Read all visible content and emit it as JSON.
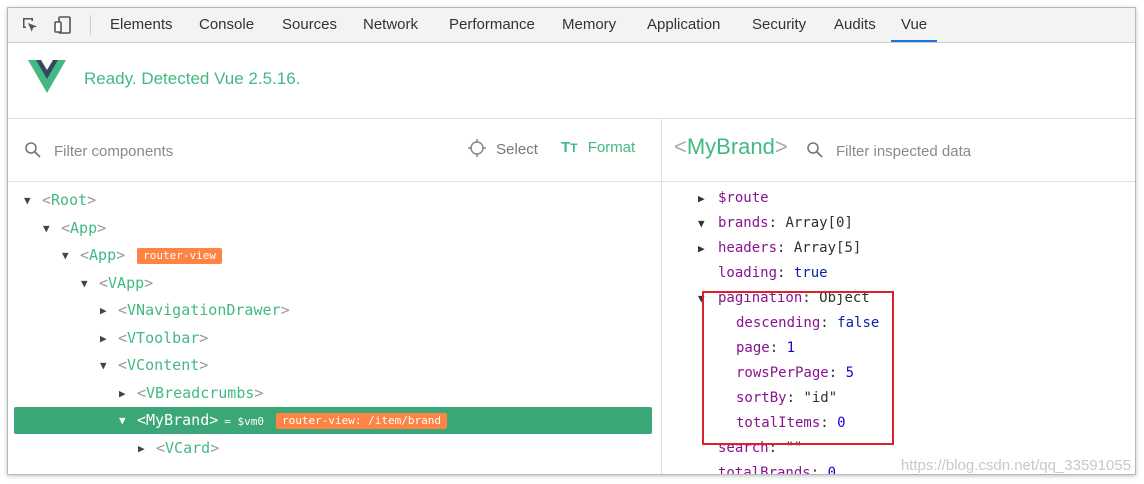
{
  "tabs": [
    "Elements",
    "Console",
    "Sources",
    "Network",
    "Performance",
    "Memory",
    "Application",
    "Security",
    "Audits",
    "Vue"
  ],
  "active_tab": "Vue",
  "header": {
    "status": "Ready. Detected Vue 2.5.16."
  },
  "left": {
    "filter_placeholder": "Filter components",
    "select_label": "Select",
    "format_label": "Format"
  },
  "tree": [
    {
      "name": "Root",
      "expanded": true
    },
    {
      "name": "App",
      "expanded": true
    },
    {
      "name": "App",
      "expanded": true,
      "badge": "router-view"
    },
    {
      "name": "VApp",
      "expanded": true
    },
    {
      "name": "VNavigationDrawer",
      "expanded": false
    },
    {
      "name": "VToolbar",
      "expanded": false
    },
    {
      "name": "VContent",
      "expanded": true
    },
    {
      "name": "VBreadcrumbs",
      "expanded": false
    },
    {
      "name": "MyBrand",
      "expanded": true,
      "selected": true,
      "vm": "= $vm0",
      "badge": "router-view: /item/brand"
    },
    {
      "name": "VCard",
      "expanded": false
    }
  ],
  "inspector": {
    "component": "MyBrand",
    "filter_placeholder": "Filter inspected data",
    "props": [
      {
        "key": "$route",
        "value": "",
        "arrow": "right"
      },
      {
        "key": "brands",
        "value": "Array[0]",
        "arrow": "down"
      },
      {
        "key": "headers",
        "value": "Array[5]",
        "arrow": "right"
      },
      {
        "key": "loading",
        "value": "true"
      },
      {
        "key": "pagination",
        "value": "Object",
        "arrow": "down"
      },
      {
        "key": "descending",
        "value": "false"
      },
      {
        "key": "page",
        "value": "1"
      },
      {
        "key": "rowsPerPage",
        "value": "5"
      },
      {
        "key": "sortBy",
        "value": "\"id\""
      },
      {
        "key": "totalItems",
        "value": "0"
      },
      {
        "key": "search",
        "value": "\"\""
      },
      {
        "key": "totalBrands",
        "value": "0"
      }
    ]
  },
  "watermark": "https://blog.csdn.net/qq_33591055",
  "colors": {
    "vue_green": "#42b983",
    "selected_row": "#3ba776",
    "badge": "#ff8344",
    "highlight": "#d9232a"
  }
}
